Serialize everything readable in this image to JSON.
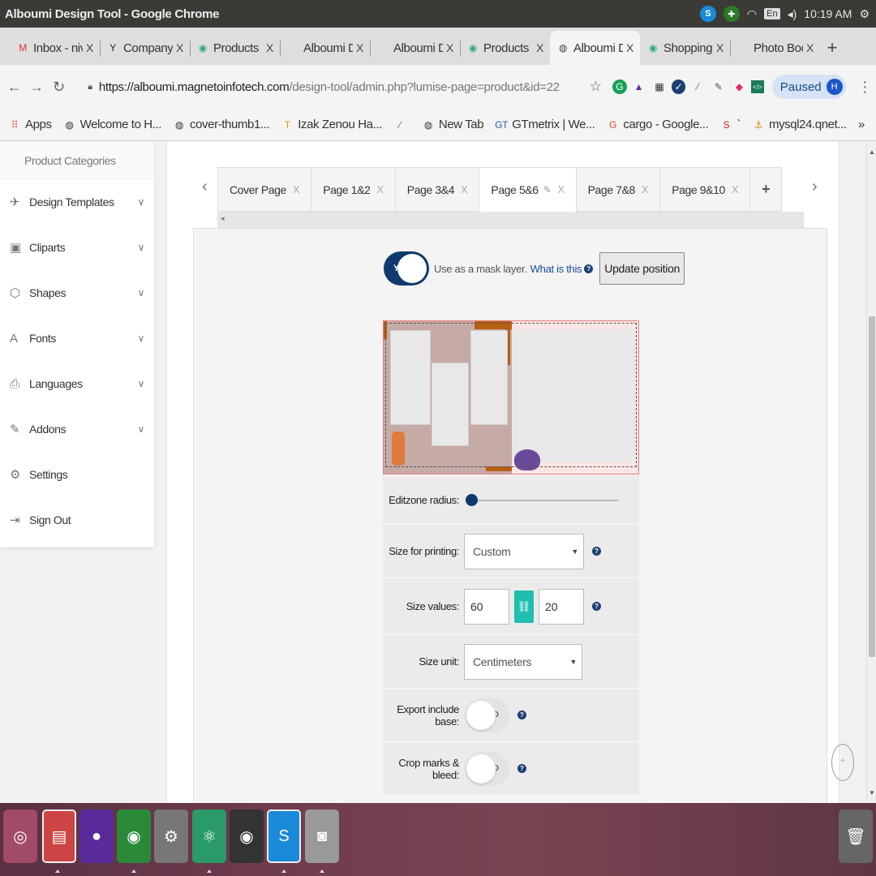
{
  "os": {
    "window_title": "Alboumi Design Tool - Google Chrome",
    "clock": "10:19 AM",
    "keyboard": "En"
  },
  "browser": {
    "tabs": [
      {
        "label": "Inbox - niv",
        "icon": "gmail-icon",
        "icon_glyph": "M",
        "icon_color": "#d33"
      },
      {
        "label": "Company D",
        "icon": "y-icon",
        "icon_glyph": "Y",
        "icon_color": "#222"
      },
      {
        "label": "Products |",
        "icon": "chrome-icon",
        "icon_glyph": "◉",
        "icon_color": "#3a7"
      },
      {
        "label": "Alboumi De",
        "icon": "blank-icon",
        "icon_glyph": "",
        "icon_color": "#999"
      },
      {
        "label": "Alboumi De",
        "icon": "blank-icon",
        "icon_glyph": "",
        "icon_color": "#999"
      },
      {
        "label": "Products |",
        "icon": "chrome-icon",
        "icon_glyph": "◉",
        "icon_color": "#3a7"
      },
      {
        "label": "Alboumi De",
        "icon": "globe-icon",
        "icon_glyph": "◍",
        "icon_color": "#444",
        "active": true
      },
      {
        "label": "Shopping C",
        "icon": "chrome-icon",
        "icon_glyph": "◉",
        "icon_color": "#3a7"
      },
      {
        "label": "Photo Boo",
        "icon": "blank-icon",
        "icon_glyph": "",
        "icon_color": "#999"
      }
    ],
    "tab_close": "X",
    "new_tab": "+",
    "url_host": "https://alboumi.magnetoinfotech.com",
    "url_path": "/design-tool/admin.php?lumise-page=product&id=22",
    "paused_label": "Paused",
    "avatar_letter": "H",
    "bookmarks": [
      {
        "label": "Apps",
        "icon_glyph": "⠿",
        "icon_color": "#d44"
      },
      {
        "label": "Welcome to H...",
        "icon_glyph": "◍",
        "icon_color": "#333"
      },
      {
        "label": "cover-thumb1...",
        "icon_glyph": "◍",
        "icon_color": "#333"
      },
      {
        "label": "Izak Zenou Ha...",
        "icon_glyph": "T",
        "icon_color": "#e0a000"
      },
      {
        "label": "",
        "icon_glyph": "⁄",
        "icon_color": "#7a4bc8"
      },
      {
        "label": "New Tab",
        "icon_glyph": "◍",
        "icon_color": "#333"
      },
      {
        "label": "GTmetrix | We...",
        "icon_glyph": "GT",
        "icon_color": "#2a5ca8"
      },
      {
        "label": "cargo - Google...",
        "icon_glyph": "G",
        "icon_color": "#e04a2a"
      },
      {
        "label": "`",
        "icon_glyph": "S",
        "icon_color": "#c22"
      },
      {
        "label": "mysql24.qnet...",
        "icon_glyph": "⚓",
        "icon_color": "#c80"
      }
    ],
    "more": "»"
  },
  "sidebar": {
    "category_title": "Product Categories",
    "items": [
      {
        "label": "Design Templates",
        "icon": "paper-plane-icon",
        "glyph": "✈",
        "arrow": "∨"
      },
      {
        "label": "Cliparts",
        "icon": "image-icon",
        "glyph": "▣",
        "arrow": "∨"
      },
      {
        "label": "Shapes",
        "icon": "cube-icon",
        "glyph": "⬡",
        "arrow": "∨"
      },
      {
        "label": "Fonts",
        "icon": "font-icon",
        "glyph": "A",
        "arrow": "∨"
      },
      {
        "label": "Languages",
        "icon": "language-icon",
        "glyph": "⎙",
        "arrow": "∨"
      },
      {
        "label": "Addons",
        "icon": "plug-icon",
        "glyph": "✎",
        "arrow": "∨"
      },
      {
        "label": "Settings",
        "icon": "gear-icon",
        "glyph": "⚙",
        "arrow": ""
      },
      {
        "label": "Sign Out",
        "icon": "sign-out-icon",
        "glyph": "⇥",
        "arrow": ""
      }
    ]
  },
  "page_tabs": {
    "prev": "‹",
    "next": "›",
    "tabs": [
      {
        "label": "Cover Page",
        "close": "X"
      },
      {
        "label": "Page 1&2",
        "close": "X"
      },
      {
        "label": "Page 3&4",
        "close": "X"
      },
      {
        "label": "Page 5&6",
        "close": "X",
        "active": true
      },
      {
        "label": "Page 7&8",
        "close": "X"
      },
      {
        "label": "Page 9&10",
        "close": "X"
      }
    ],
    "add": "+"
  },
  "mask": {
    "toggle_label": "YES",
    "text": "Use as a mask layer.",
    "link": "What is this",
    "help": "?",
    "update_button": "Update position"
  },
  "settings": {
    "editzone_label": "Editzone radius:",
    "editzone_radius_value": 0,
    "size_print_label": "Size for printing:",
    "size_print_value": "Custom",
    "size_values_label": "Size values:",
    "size_width": "60",
    "size_height": "20",
    "size_unit_label": "Size unit:",
    "size_unit_value": "Centimeters",
    "export_label": "Export include base:",
    "export_value": "NO",
    "crop_label": "Crop marks & bleed:",
    "crop_value": "NO",
    "help": "?"
  },
  "colors": {
    "primary": "#0f3a6e",
    "link_button": "#1ebfae",
    "canvas_left": "#c6aaa6",
    "accent_orange": "#b86012"
  }
}
